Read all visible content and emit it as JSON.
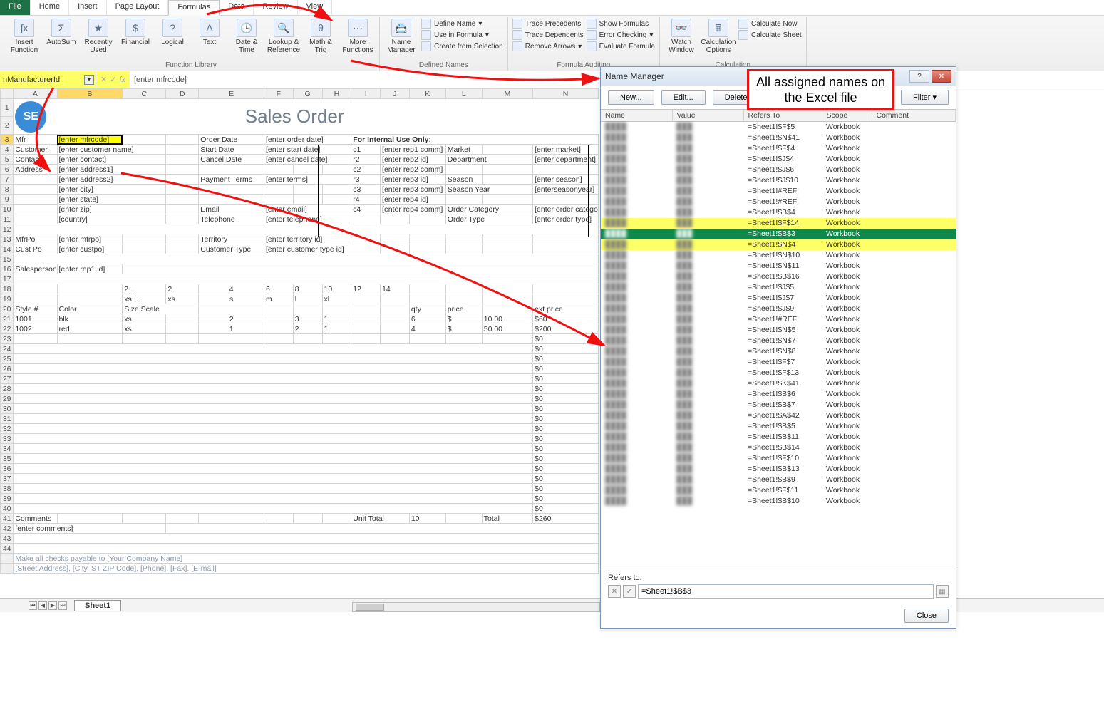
{
  "tabs": {
    "file": "File",
    "home": "Home",
    "insert": "Insert",
    "page": "Page Layout",
    "formulas": "Formulas",
    "data": "Data",
    "review": "Review",
    "view": "View"
  },
  "ribbon": {
    "insert_function": "Insert\nFunction",
    "autosum": "AutoSum",
    "recent": "Recently\nUsed",
    "financial": "Financial",
    "logical": "Logical",
    "text": "Text",
    "date": "Date &\nTime",
    "lookup": "Lookup &\nReference",
    "math": "Math\n& Trig",
    "more": "More\nFunctions",
    "group_fl": "Function Library",
    "name_mgr": "Name\nManager",
    "define": "Define Name",
    "usein": "Use in Formula",
    "createfrom": "Create from Selection",
    "group_dn": "Defined Names",
    "trace_p": "Trace Precedents",
    "trace_d": "Trace Dependents",
    "remove_a": "Remove Arrows",
    "show_f": "Show Formulas",
    "err_c": "Error Checking",
    "eval_f": "Evaluate Formula",
    "group_fa": "Formula Auditing",
    "watch": "Watch\nWindow",
    "calc_opt": "Calculation\nOptions",
    "calc_now": "Calculate Now",
    "calc_sheet": "Calculate Sheet",
    "group_calc": "Calculation"
  },
  "namebox": "nManufacturerId",
  "fxvalue": "[enter mfrcode]",
  "sheet": {
    "title": "Sales Order",
    "logo": "SE",
    "labels": {
      "mfr": "Mfr",
      "customer": "Customer",
      "contact": "Contact",
      "address": "Address",
      "orderdate": "Order Date",
      "startdate": "Start Date",
      "canceldate": "Cancel Date",
      "payterms": "Payment Terms",
      "email": "Email",
      "telephone": "Telephone",
      "mfrpo": "MfrPo",
      "custpo": "Cust Po",
      "territory": "Territory",
      "custtype": "Customer Type",
      "salesperson": "Salesperson",
      "internal": "For Internal Use Only:",
      "market": "Market",
      "department": "Department",
      "season": "Season",
      "seasonyear": "Season Year",
      "ordercat": "Order Category",
      "ordertype": "Order Type",
      "style": "Style #",
      "color": "Color",
      "sizescale": "Size Scale",
      "qty": "qty",
      "price": "price",
      "extprice": "ext price",
      "unittotal": "Unit Total",
      "total": "Total",
      "comments": "Comments"
    },
    "ph": {
      "mfrcode": "[enter mfrcode]",
      "custname": "[enter customer name]",
      "contact": "[enter contact]",
      "addr1": "[enter address1]",
      "addr2": "[enter address2]",
      "city": "[enter city]",
      "state": "[enter state]",
      "zip": "[enter zip]",
      "country": "[country]",
      "orderdate": "[enter order date]",
      "startdate": "[enter start date]",
      "canceldate": "[enter cancel date]",
      "terms": "[enter terms]",
      "email": "[enter email]",
      "telephone": "[enter telephone]",
      "mfrpo": "[enter mfrpo]",
      "custpo": "[enter custpo]",
      "territory": "[enter territory id]",
      "custtype": "[enter customer type id]",
      "rep1": "[enter rep1 id]",
      "c1": "c1",
      "c2": "c2",
      "c3": "c3",
      "c4": "c4",
      "r2": "r2",
      "r3": "r3",
      "r4": "r4",
      "rep1c": "[enter rep1 comm]",
      "rep2id": "[enter rep2 id]",
      "rep2c": "[enter rep2 comm]",
      "rep3id": "[enter rep3 id]",
      "rep3c": "[enter rep3 comm]",
      "rep4id": "[enter rep4 id]",
      "rep4c": "[enter rep4 comm]",
      "market": "[enter market]",
      "department": "[enter department]",
      "season": "[enter season]",
      "seasonyear": "[enterseasonyear]",
      "ordercat": "[enter order category]",
      "ordertype": "[enter order type]",
      "comments": "[enter comments]"
    },
    "sizehdr": [
      "2...",
      "2",
      "4",
      "6",
      "8",
      "10",
      "12",
      "14"
    ],
    "sizerow": [
      "xs...",
      "xs",
      "s",
      "m",
      "l",
      "xl"
    ],
    "rows": [
      {
        "style": "1001",
        "color": "blk",
        "scale": "xs",
        "c": [
          "2",
          "",
          "3",
          "1"
        ],
        "qty": "6",
        "cur": "$",
        "price": "10.00",
        "ecur": "$",
        "ext": "60"
      },
      {
        "style": "1002",
        "color": "red",
        "scale": "xs",
        "c": [
          "1",
          "",
          "2",
          "1"
        ],
        "qty": "4",
        "cur": "$",
        "price": "50.00",
        "ecur": "$",
        "ext": "200"
      }
    ],
    "zero": "0",
    "dollar": "$",
    "unittotal_v": "10",
    "total_v": "260",
    "foot1": "Make all checks payable to [Your Company Name]",
    "foot2": "[Street Address], [City, ST ZIP Code], [Phone], [Fax], [E-mail]",
    "sheetname": "Sheet1"
  },
  "nm": {
    "title": "Name Manager",
    "new": "New...",
    "edit": "Edit...",
    "delete": "Delete",
    "filter": "Filter",
    "h_name": "Name",
    "h_value": "Value",
    "h_refers": "Refers To",
    "h_scope": "Scope",
    "h_comment": "Comment",
    "scope": "Workbook",
    "refs": [
      "=Sheet1!$F$5",
      "=Sheet1!$N$41",
      "=Sheet1!$F$4",
      "=Sheet1!$J$4",
      "=Sheet1!$J$6",
      "=Sheet1!$J$10",
      "=Sheet1!#REF!",
      "=Sheet1!#REF!",
      "=Sheet1!$B$4",
      "=Sheet1!$F$14",
      "=Sheet1!$B$3",
      "=Sheet1!$N$4",
      "=Sheet1!$N$10",
      "=Sheet1!$N$11",
      "=Sheet1!$B$16",
      "=Sheet1!$J$5",
      "=Sheet1!$J$7",
      "=Sheet1!$J$9",
      "=Sheet1!#REF!",
      "=Sheet1!$N$5",
      "=Sheet1!$N$7",
      "=Sheet1!$N$8",
      "=Sheet1!$F$7",
      "=Sheet1!$F$13",
      "=Sheet1!$K$41",
      "=Sheet1!$B$6",
      "=Sheet1!$B$7",
      "=Sheet1!$A$42",
      "=Sheet1!$B$5",
      "=Sheet1!$B$11",
      "=Sheet1!$B$14",
      "=Sheet1!$F$10",
      "=Sheet1!$B$13",
      "=Sheet1!$B$9",
      "=Sheet1!$F$11",
      "=Sheet1!$B$10"
    ],
    "refersto_lbl": "Refers to:",
    "refersto_val": "=Sheet1!$B$3",
    "close": "Close"
  },
  "callout": {
    "l1": "All assigned names on",
    "l2": "the Excel file"
  }
}
